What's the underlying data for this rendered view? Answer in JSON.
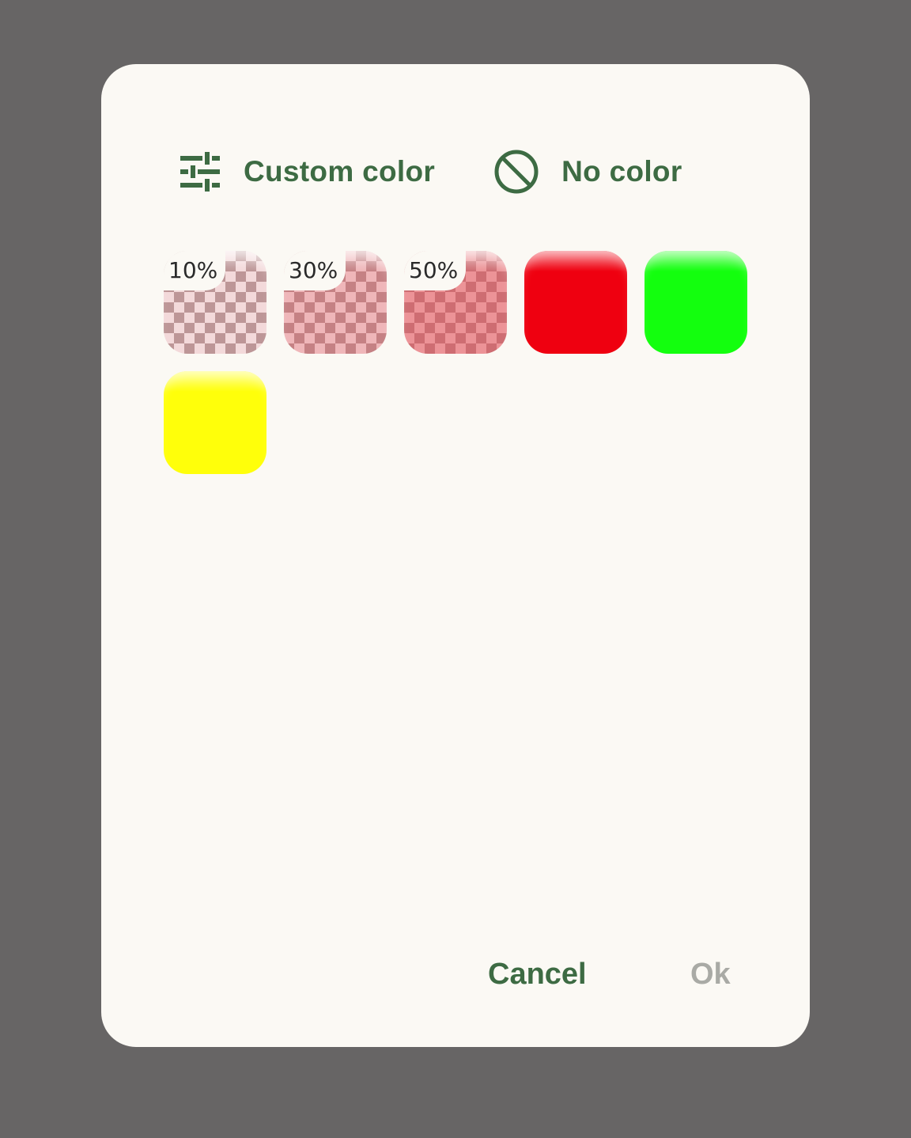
{
  "dialog": {
    "custom_color": {
      "label": "Custom color",
      "icon": "sliders-icon"
    },
    "no_color": {
      "label": "No color",
      "icon": "block-icon"
    },
    "swatches": [
      {
        "name": "swatch-red-10",
        "label": "10%",
        "color": "#e23a43",
        "opacity_percent": 10
      },
      {
        "name": "swatch-red-30",
        "label": "30%",
        "color": "#e23a43",
        "opacity_percent": 30
      },
      {
        "name": "swatch-red-50",
        "label": "50%",
        "color": "#e23a43",
        "opacity_percent": 50
      },
      {
        "name": "swatch-red",
        "label": "",
        "color": "#ef0010",
        "opacity_percent": 100
      },
      {
        "name": "swatch-green",
        "label": "",
        "color": "#13ff0e",
        "opacity_percent": 100
      },
      {
        "name": "swatch-yellow",
        "label": "",
        "color": "#ffff0a",
        "opacity_percent": 100
      }
    ],
    "buttons": {
      "cancel": "Cancel",
      "ok": "Ok"
    }
  },
  "colors": {
    "accent": "#3d6b43",
    "disabled": "#a9aaa5",
    "dialog_bg": "#fbf9f4",
    "scrim": "#676565"
  }
}
